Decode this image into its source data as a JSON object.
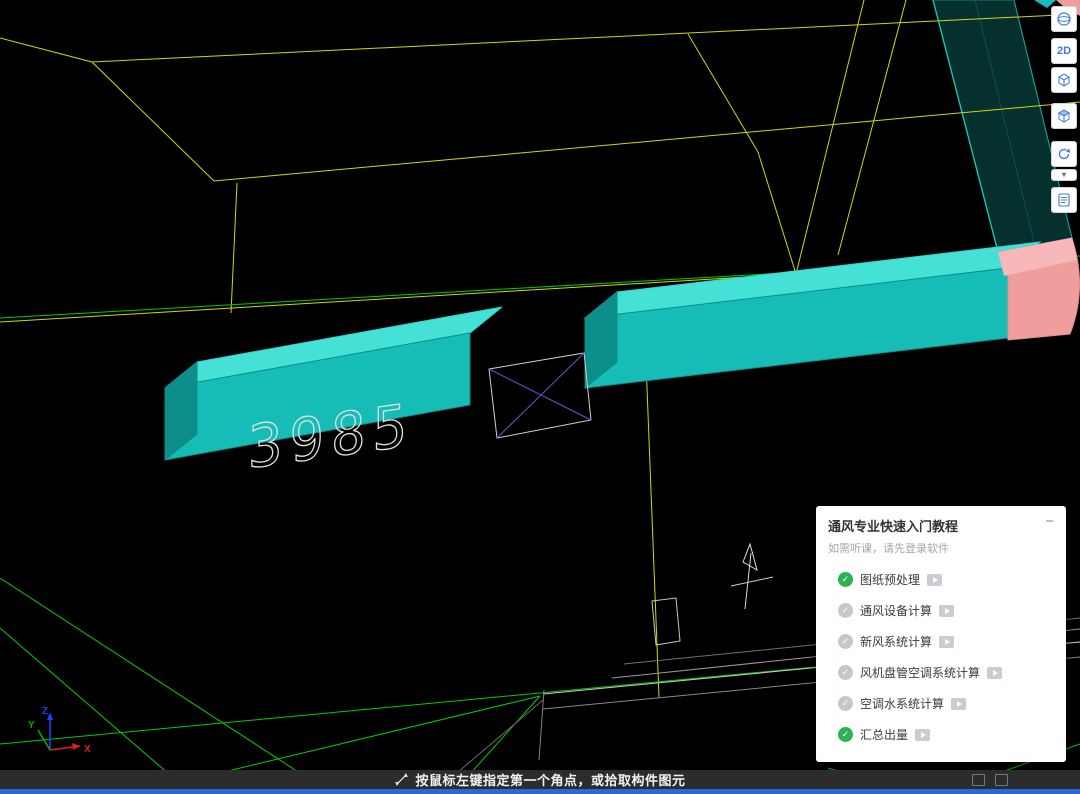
{
  "viewport": {
    "dimension_label": "3985"
  },
  "ucs": {
    "x": "X",
    "y": "Y",
    "z": "Z"
  },
  "view_toolbar": {
    "plan_label": "2D",
    "chevron_glyph": "▾"
  },
  "tutorial_panel": {
    "title": "通风专业快速入门教程",
    "subtitle": "如需听课，请先登录软件",
    "minimize_glyph": "−",
    "check_glyph": "✓",
    "items": [
      {
        "label": "图纸预处理",
        "status": "done"
      },
      {
        "label": "通风设备计算",
        "status": "pending"
      },
      {
        "label": "新风系统计算",
        "status": "pending"
      },
      {
        "label": "风机盘管空调系统计算",
        "status": "pending"
      },
      {
        "label": "空调水系统计算",
        "status": "pending"
      },
      {
        "label": "汇总出量",
        "status": "done"
      }
    ]
  },
  "status_bar": {
    "message": "按鼠标左键指定第一个角点，或拾取构件图元"
  },
  "colors": {
    "duct_top": "#45e0d6",
    "duct_front": "#16bdb7",
    "duct_end": "#0c8f8b",
    "elbow_pink": "#ef9d9d",
    "grid_yellow": "#d6d600",
    "grid_green": "#00cc00",
    "taskbar_blue": "#2b6ad4"
  }
}
